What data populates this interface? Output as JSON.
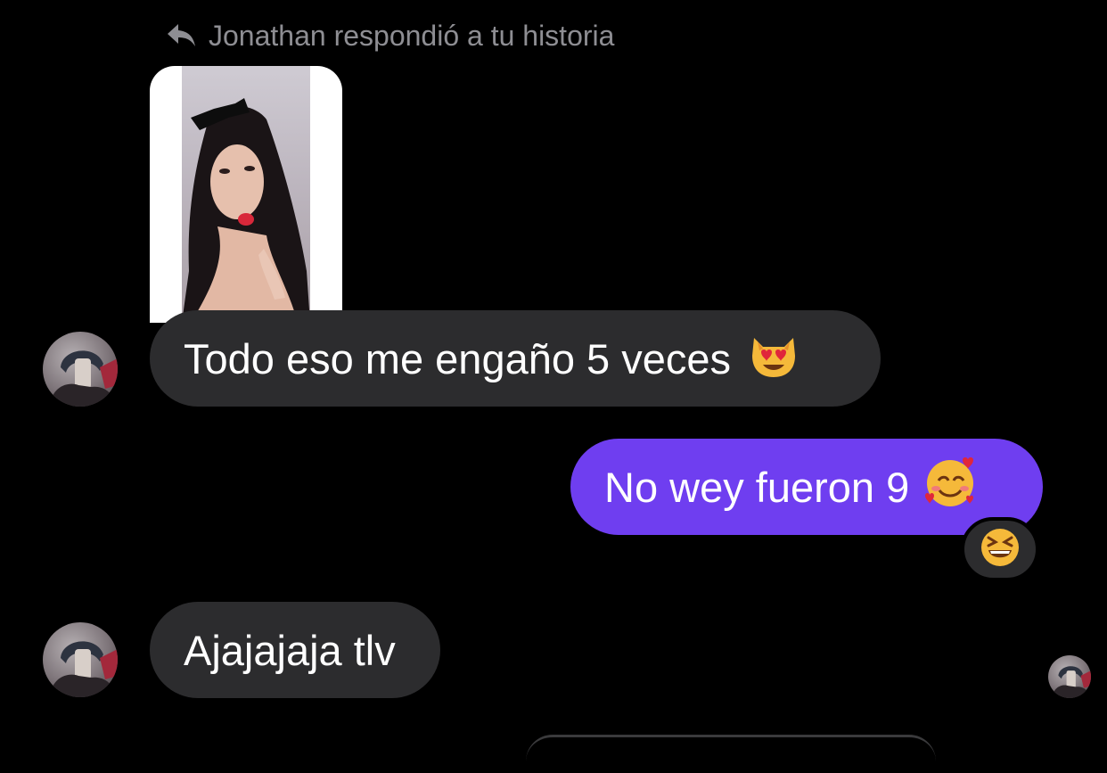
{
  "reply_header": {
    "icon": "reply-arrow-icon",
    "text": "Jonathan respondió a tu historia"
  },
  "messages": [
    {
      "direction": "incoming",
      "text": "Todo eso me engaño 5 veces",
      "emoji": "heart-eyes-cat-emoji"
    },
    {
      "direction": "outgoing",
      "text": "No wey fueron 9",
      "emoji": "smiling-face-with-hearts-emoji",
      "reaction": "grinning-squinting-face-emoji"
    },
    {
      "direction": "incoming",
      "text": "Ajajajaja tlv"
    }
  ],
  "colors": {
    "background": "#000000",
    "incoming_bubble": "#2c2c2e",
    "outgoing_bubble": "#6f3ef0",
    "secondary_text": "#8e8e93"
  }
}
